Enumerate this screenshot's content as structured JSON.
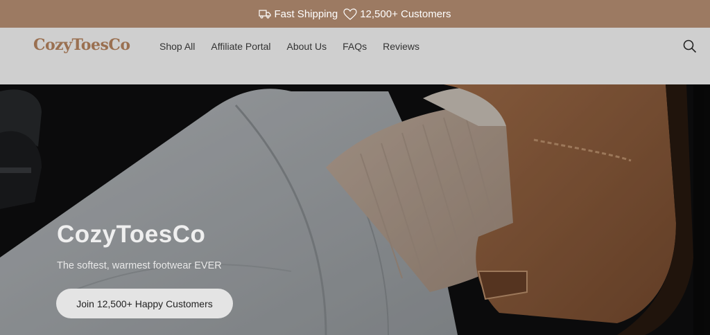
{
  "announcement": {
    "shipping_text": "Fast Shipping",
    "shipping_icon": "truck-icon",
    "customers_text": "12,500+ Customers",
    "customers_icon": "heart-icon",
    "background_color": "#9c7a62"
  },
  "header": {
    "logo": "CozyToesCo",
    "logo_color": "#9a7051",
    "nav": [
      {
        "label": "Shop All"
      },
      {
        "label": "Affiliate Portal"
      },
      {
        "label": "About Us"
      },
      {
        "label": "FAQs"
      },
      {
        "label": "Reviews"
      }
    ],
    "search_icon": "search-icon"
  },
  "hero": {
    "title": "CozyToesCo",
    "subtitle": "The softest, warmest footwear EVER",
    "cta_label": "Join 12,500+ Happy Customers"
  }
}
